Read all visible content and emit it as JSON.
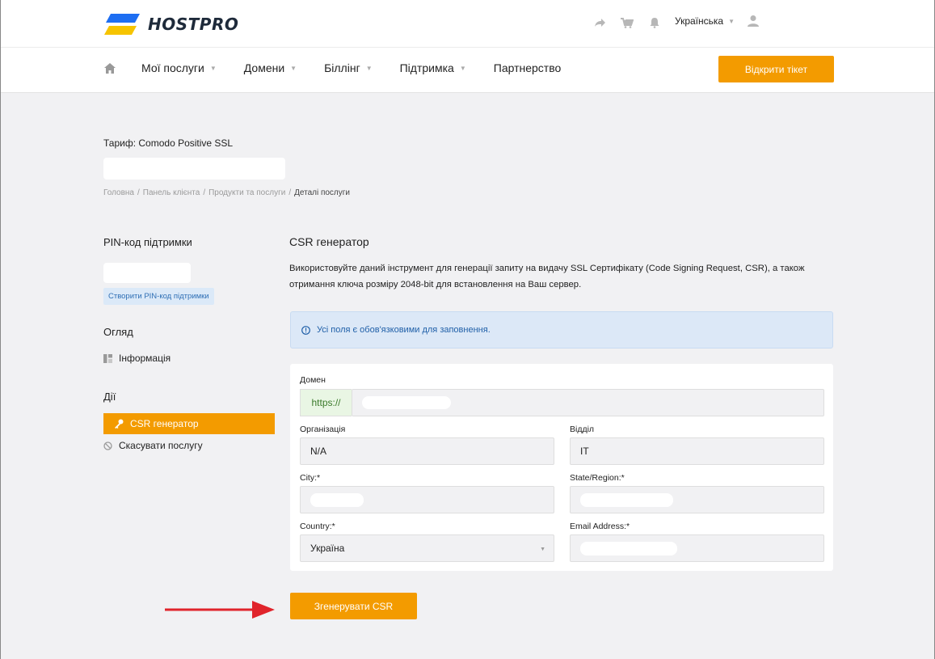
{
  "header": {
    "brand": "HOSTPRO",
    "language": "Українська",
    "open_ticket": "Відкрити тікет"
  },
  "nav": {
    "items": [
      {
        "label": "Мої послуги",
        "dropdown": true
      },
      {
        "label": "Домени",
        "dropdown": true
      },
      {
        "label": "Біллінг",
        "dropdown": true
      },
      {
        "label": "Підтримка",
        "dropdown": true
      },
      {
        "label": "Партнерство",
        "dropdown": false
      }
    ]
  },
  "page": {
    "tariff": "Тариф: Comodo Positive SSL",
    "breadcrumb": [
      "Головна",
      "Панель клієнта",
      "Продукти та послуги",
      "Деталі послуги"
    ]
  },
  "sidebar": {
    "pin_title": "PIN-код підтримки",
    "pin_button": "Створити PIN-код підтримки",
    "overview_title": "Огляд",
    "info_link": "Інформація",
    "actions_title": "Дії",
    "csr_link": "CSR генератор",
    "cancel_link": "Скасувати послугу"
  },
  "main": {
    "title": "CSR генератор",
    "description": "Використовуйте даний інструмент для генерації запиту на видачу SSL Сертифікату (Code Signing Request, CSR), а також отримання ключа розміру 2048-bit для встановлення на Ваш сервер.",
    "alert": "Усі поля є обов'язковими для заповнення."
  },
  "form": {
    "domain_label": "Домен",
    "domain_prefix": "https://",
    "org_label": "Організація",
    "org_value": "N/A",
    "dept_label": "Відділ",
    "dept_value": "IT",
    "city_label": "City:*",
    "state_label": "State/Region:*",
    "country_label": "Country:*",
    "country_value": "Україна",
    "email_label": "Email Address:*",
    "submit": "Згенерувати CSR"
  },
  "colors": {
    "accent": "#f39b00",
    "alert_bg": "#dce8f7",
    "alert_text": "#1f5fa8",
    "arrow": "#e0242b"
  }
}
